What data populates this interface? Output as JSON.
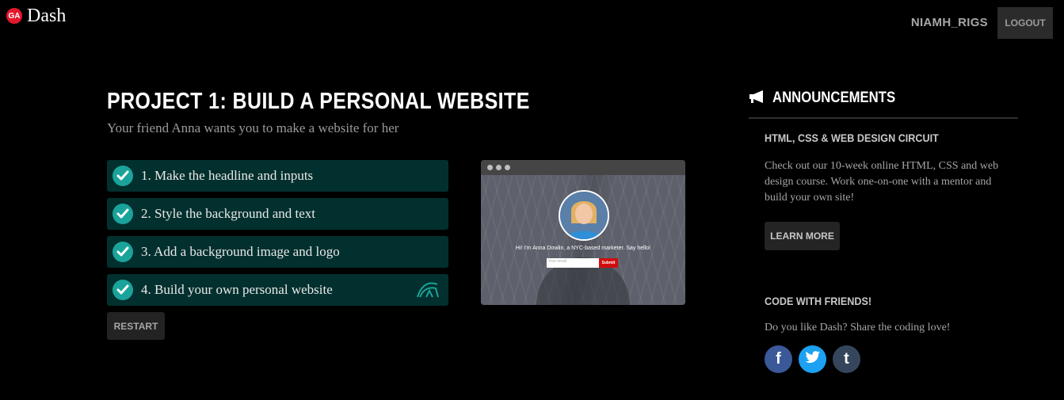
{
  "header": {
    "logo_badge": "GA",
    "app_name": "Dash",
    "username": "NIAMH_RIGS",
    "logout_label": "LOGOUT"
  },
  "project": {
    "title": "PROJECT 1: BUILD A PERSONAL WEBSITE",
    "subtitle": "Your friend Anna wants you to make a website for her",
    "steps": [
      {
        "label": "1. Make the headline and inputs",
        "completed": true
      },
      {
        "label": "2. Style the background and text",
        "completed": true
      },
      {
        "label": "3. Add a background image and logo",
        "completed": true
      },
      {
        "label": "4. Build your own personal website",
        "completed": true
      }
    ],
    "restart_label": "RESTART"
  },
  "preview": {
    "caption": "Hi! I'm Anna Dowlin, a NYC-based marketer. Say hello!",
    "input_placeholder": "Your email",
    "submit_label": "Submit"
  },
  "sidebar": {
    "announcements_title": "ANNOUNCEMENTS",
    "circuit_title": "HTML, CSS & WEB DESIGN CIRCUIT",
    "circuit_body": "Check out our 10-week online HTML, CSS and web design course. Work one-on-one with a mentor and build your own site!",
    "learn_more_label": "LEARN MORE",
    "friends_title": "CODE WITH FRIENDS!",
    "friends_body": "Do you like Dash? Share the coding love!",
    "social": [
      {
        "name": "facebook",
        "glyph": "f",
        "color": "#3b5998"
      },
      {
        "name": "twitter",
        "glyph": "t",
        "color": "#1da1f2"
      },
      {
        "name": "tumblr",
        "glyph": "t",
        "color": "#35465c"
      }
    ]
  },
  "colors": {
    "accent_red": "#e4172b",
    "step_bg": "#02302e",
    "check_teal": "#1aa39a"
  }
}
